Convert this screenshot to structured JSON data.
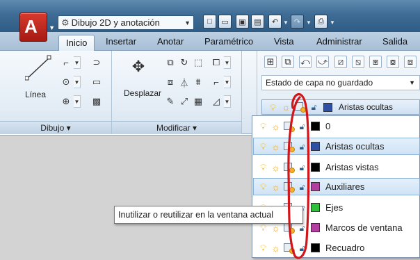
{
  "app": {
    "logo": "A",
    "workspace": "Dibujo 2D y anotación",
    "quick_access": [
      "new-icon",
      "open-icon",
      "save-icon",
      "saveas-icon",
      "undo-icon",
      "redo-icon",
      "plot-icon"
    ]
  },
  "tabs": [
    {
      "label": "Inicio",
      "active": true
    },
    {
      "label": "Insertar",
      "active": false
    },
    {
      "label": "Anotar",
      "active": false
    },
    {
      "label": "Paramétrico",
      "active": false
    },
    {
      "label": "Vista",
      "active": false
    },
    {
      "label": "Administrar",
      "active": false
    },
    {
      "label": "Salida",
      "active": false
    }
  ],
  "ribbon": {
    "panels": {
      "dibujo": "Dibujo ▾",
      "modificar": "Modificar ▾"
    },
    "linea_label": "Línea",
    "desplazar_label": "Desplazar",
    "layer_state": "Estado de capa no guardado",
    "current_layer": {
      "name": "Aristas ocultas",
      "color": "#2e4fa3"
    }
  },
  "layers": [
    {
      "name": "0",
      "color": "#000000",
      "selected": false
    },
    {
      "name": "Aristas ocultas",
      "color": "#2e4fa3",
      "selected": true
    },
    {
      "name": "Aristas vistas",
      "color": "#000000",
      "selected": false
    },
    {
      "name": "Auxiliares",
      "color": "#b03fa0",
      "selected": true
    },
    {
      "name": "Ejes",
      "color": "#2fbf3a",
      "selected": false
    },
    {
      "name": "Marcos de ventana",
      "color": "#b03fa0",
      "selected": false
    },
    {
      "name": "Recuadro",
      "color": "#000000",
      "selected": false
    }
  ],
  "tooltip": "Inutilizar o reutilizar en la ventana actual",
  "colors": {
    "annotation": "#d0161b",
    "selection": "#cfe3f6"
  }
}
